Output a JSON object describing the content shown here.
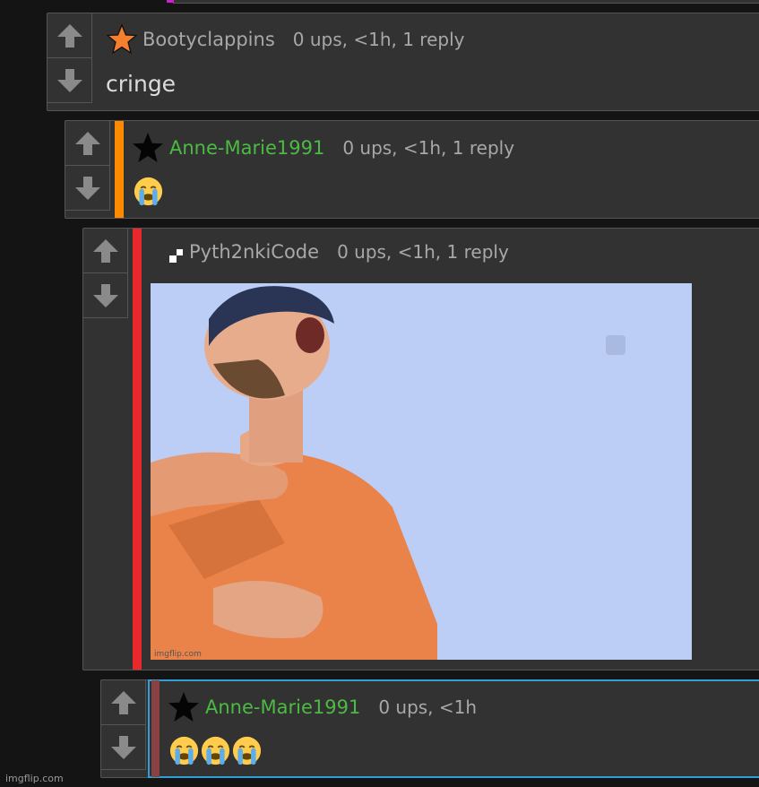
{
  "comments": [
    {
      "user": "Bootyclappins",
      "meta": "0 ups, <1h, 1 reply",
      "text": "cringe",
      "badge": "orange-star-icon",
      "bar_color": ""
    },
    {
      "user": "Anne-Marie1991",
      "meta": "0 ups, <1h, 1 reply",
      "text": "😭",
      "badge": "black-star-icon",
      "bar_color": "#ff8a00"
    },
    {
      "user": "Pyth2nkiCode",
      "meta": "0 ups, <1h, 1 reply",
      "image": {
        "watermark": "imgflip.com"
      },
      "badge": "pixel-icon",
      "bar_color": "#e8282d"
    },
    {
      "user": "Anne-Marie1991",
      "meta": "0 ups, <1h",
      "text": "😭😭😭",
      "badge": "black-star-icon",
      "bar_color": "#8a4141"
    }
  ],
  "footer": {
    "watermark": "imgflip.com"
  },
  "colors": {
    "username_green": "#4bbb42",
    "text": "#dcdcdc",
    "meta": "#a8a8a8",
    "panel": "#323232",
    "highlight_border": "#2f9fd6"
  }
}
